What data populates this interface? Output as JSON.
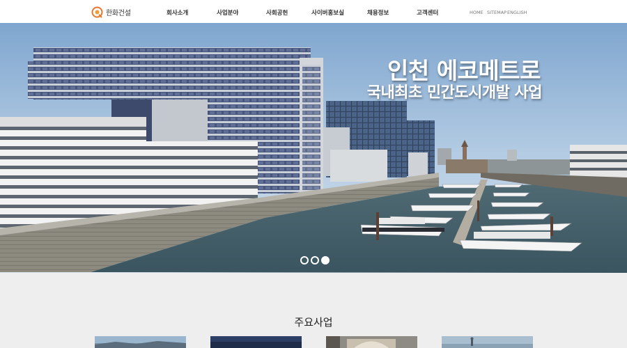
{
  "header": {
    "logo_text": "한화건설",
    "nav": [
      {
        "label": "회사소개"
      },
      {
        "label": "사업분야"
      },
      {
        "label": "사회공헌"
      },
      {
        "label": "사이버홍보실"
      },
      {
        "label": "채용정보"
      },
      {
        "label": "고객센터"
      }
    ],
    "util": [
      {
        "label": "HOME"
      },
      {
        "label": "SITEMAP"
      },
      {
        "label": "ENGLISH"
      }
    ]
  },
  "hero": {
    "title": "인천 에코메트로",
    "subtitle": "국내최초 민간도시개발 사업",
    "slides": 3,
    "active_slide": 3
  },
  "section": {
    "title": "주요사업"
  },
  "colors": {
    "brand": "#e8762c",
    "nav_text": "#333333",
    "section_bg": "#eeeeee"
  }
}
